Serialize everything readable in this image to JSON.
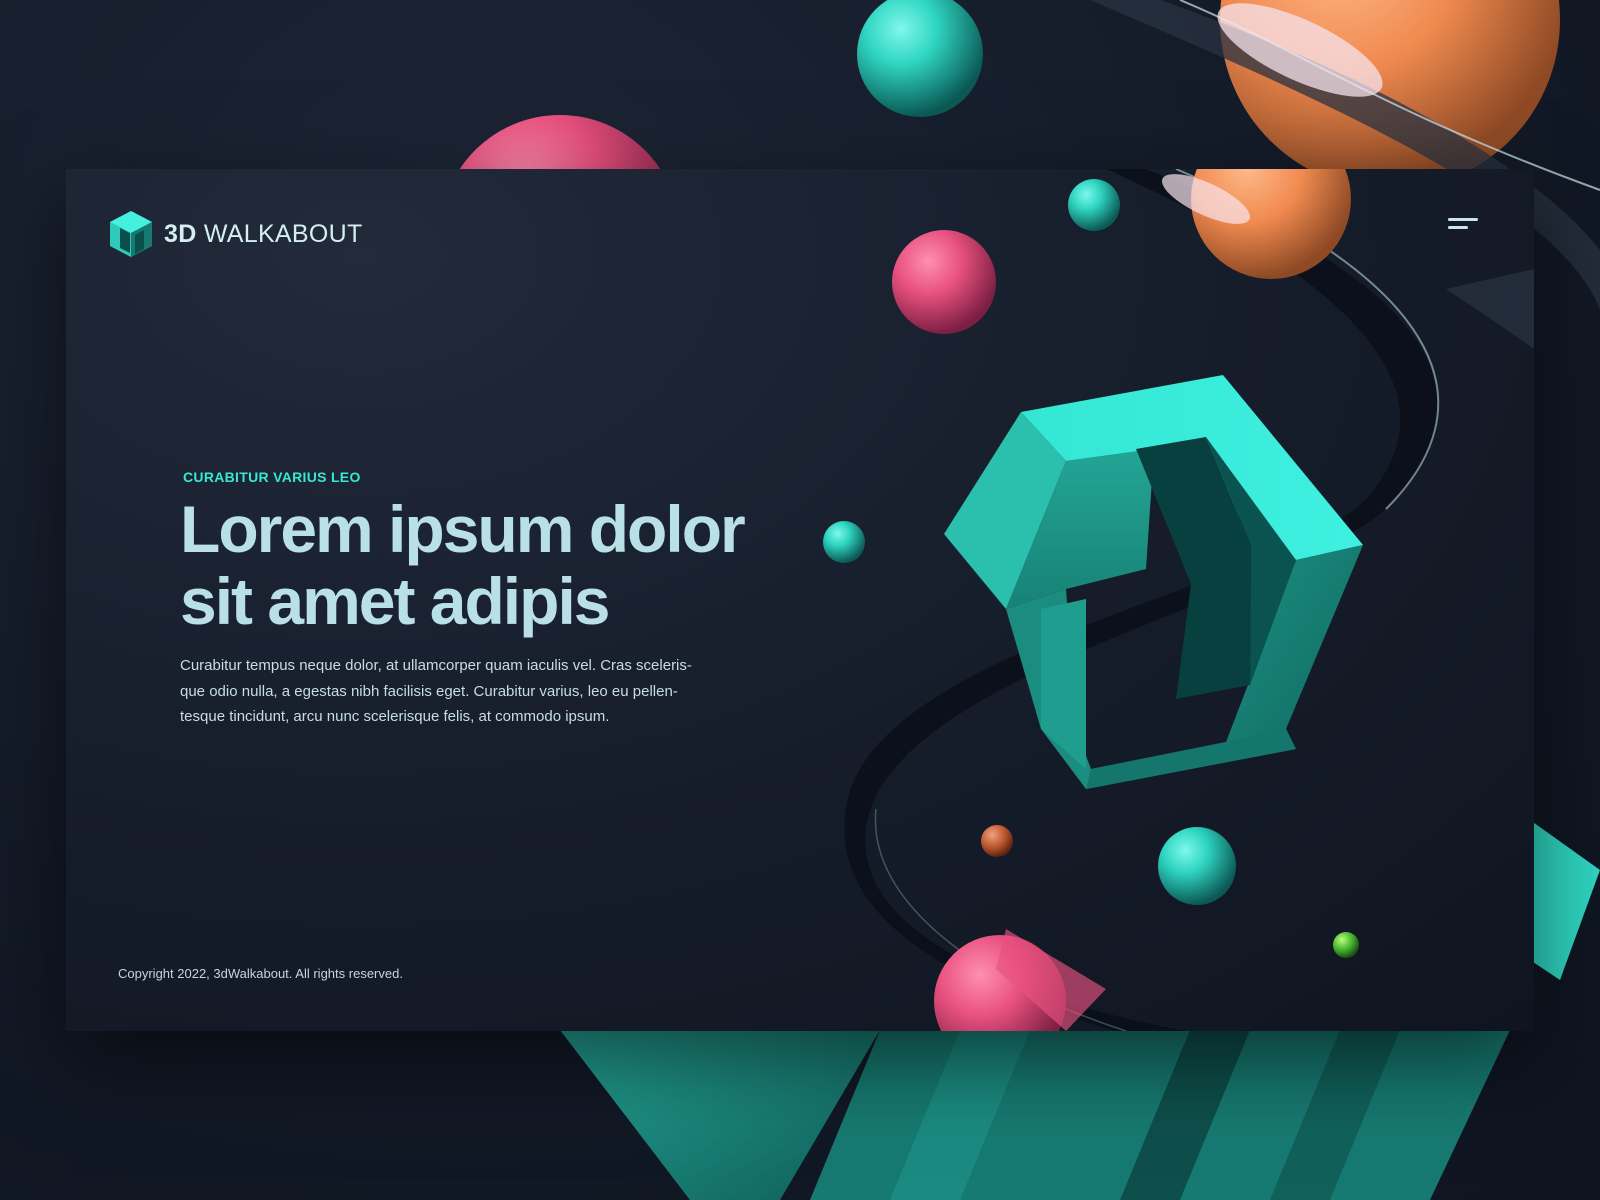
{
  "brand": {
    "name_bold": "3D",
    "name_light": "WALKABOUT",
    "accent_color": "#38e7d3"
  },
  "nav": {
    "menu_icon": "hamburger-menu-icon"
  },
  "hero": {
    "eyebrow": "CURABITUR VARIUS LEO",
    "headline_line1": "Lorem ipsum dolor",
    "headline_line2": "sit amet adipis",
    "body_line1": "Curabitur tempus neque dolor, at ullamcorper quam iaculis vel. Cras sceleris-",
    "body_line2": "que odio nulla, a egestas nibh facilisis eget. Curabitur varius, leo eu pellen-",
    "body_line3": "tesque tincidunt, arcu nunc scelerisque felis, at commodo ipsum."
  },
  "footer": {
    "copyright": "Copyright 2022, 3dWalkabout. All rights reserved."
  },
  "colors": {
    "background": "#151c2a",
    "card": "#171e2c",
    "teal": "#2fd6c2",
    "pink": "#e8517f",
    "orange": "#f08a4f",
    "headline": "#b9e0e6"
  }
}
